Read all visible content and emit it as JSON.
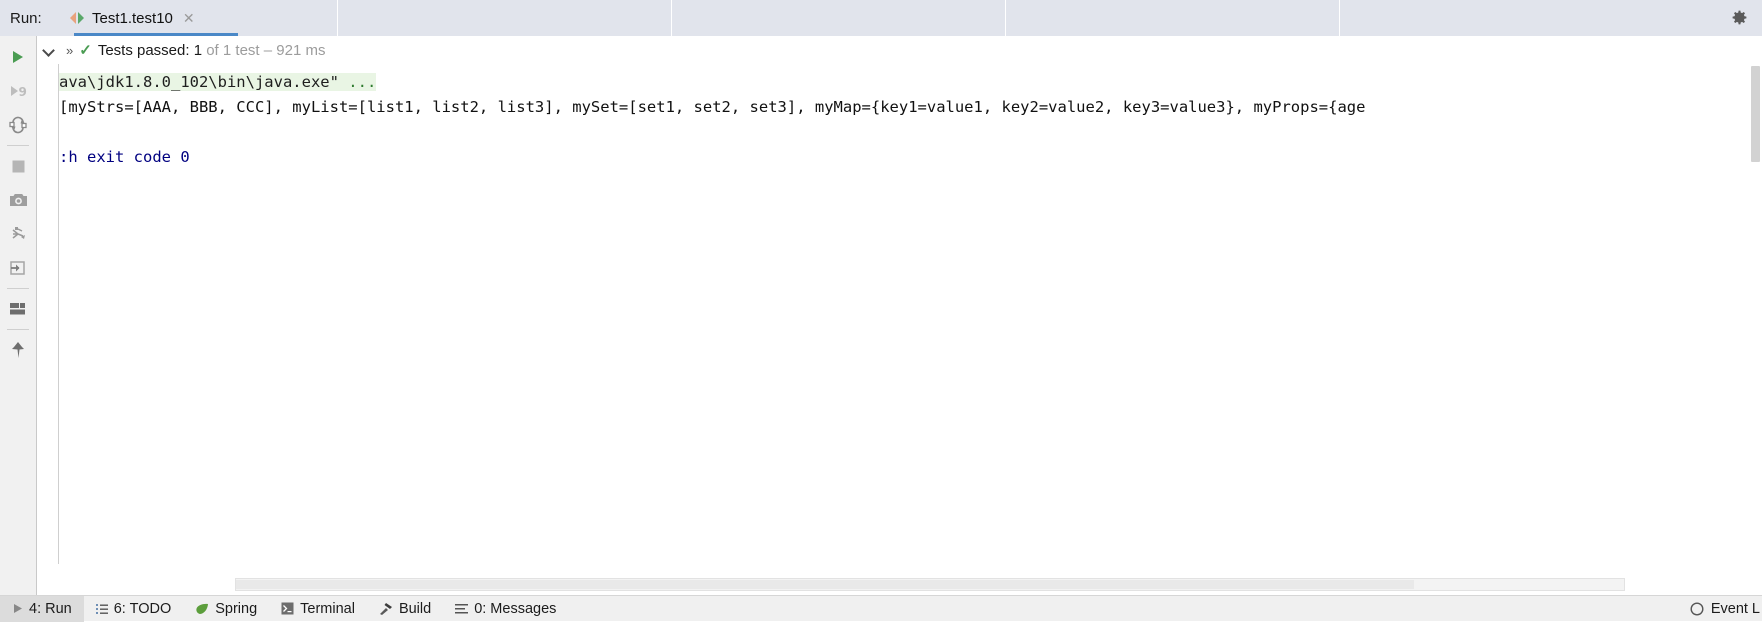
{
  "window": {
    "run_label": "Run:",
    "settings_icon": "gear-icon"
  },
  "tab": {
    "title": "Test1.test10",
    "run_icon": "run-configuration-icon",
    "close_icon": "close-icon"
  },
  "run_header": {
    "expand_icon": "chevron-down-icon",
    "double_chevron": "»",
    "check_icon": "check-mark-icon",
    "status_text": "Tests passed:",
    "passed_count": "1",
    "detail_text": "of 1 test – 921 ms"
  },
  "toolbar": {
    "items": [
      {
        "name": "rerun-button",
        "icon": "play-icon"
      },
      {
        "name": "rerun-failed-tests-button",
        "icon": "rerun-failed-icon"
      },
      {
        "name": "toggle-auto-test-button",
        "icon": "auto-test-icon"
      },
      {
        "name": "stop-button",
        "icon": "stop-square-icon"
      },
      {
        "name": "export-screenshot-button",
        "icon": "camera-icon"
      },
      {
        "name": "debug-coverage-button",
        "icon": "debug-bug-icon"
      },
      {
        "name": "export-test-results-button",
        "icon": "export-arrow-icon"
      },
      {
        "name": "layout-settings-button",
        "icon": "layout-grid-icon"
      },
      {
        "name": "pin-tab-button",
        "icon": "pin-icon"
      }
    ]
  },
  "console": {
    "lines": [
      {
        "id": "command-line",
        "type": "command",
        "text": "ava\\jdk1.8.0_102\\bin\\java.exe\" ",
        "ellipsis": "..."
      },
      {
        "id": "output-line",
        "type": "output",
        "text": "[myStrs=[AAA, BBB, CCC], myList=[list1, list2, list3], mySet=[set1, set2, set3], myMap={key1=value1, key2=value2, key3=value3}, myProps={age"
      },
      {
        "id": "blank-line",
        "type": "blank",
        "text": " "
      },
      {
        "id": "exit-code-line",
        "type": "exit",
        "text": ":h exit code 0"
      }
    ]
  },
  "scrollbars": {
    "horizontal": "horizontal-scrollbar",
    "vertical": "vertical-scrollbar"
  },
  "statusbar": {
    "items": [
      {
        "name": "status-run",
        "label": "4: Run",
        "icon": "play-icon",
        "active": true
      },
      {
        "name": "status-todo",
        "label": "6: TODO",
        "icon": "list-icon",
        "active": false
      },
      {
        "name": "status-spring",
        "label": "Spring",
        "icon": "leaf-icon",
        "active": false
      },
      {
        "name": "status-terminal",
        "label": "Terminal",
        "icon": "terminal-icon",
        "active": false
      },
      {
        "name": "status-build",
        "label": "Build",
        "icon": "hammer-icon",
        "active": false
      },
      {
        "name": "status-messages",
        "label": "0: Messages",
        "icon": "messages-icon",
        "active": false
      }
    ],
    "right": {
      "event_log_label": "Event L",
      "event_log_icon": "circle-icon"
    }
  },
  "colors": {
    "tab_strip": "#e1e4ec",
    "tab_underline": "#4a88c7",
    "console_text": "#000080",
    "command_highlight": "#e9f5e4",
    "success_green": "#4a9c52",
    "toolbar_bg": "#f1f1f1",
    "statusbar_bg": "#f0f0f0"
  }
}
